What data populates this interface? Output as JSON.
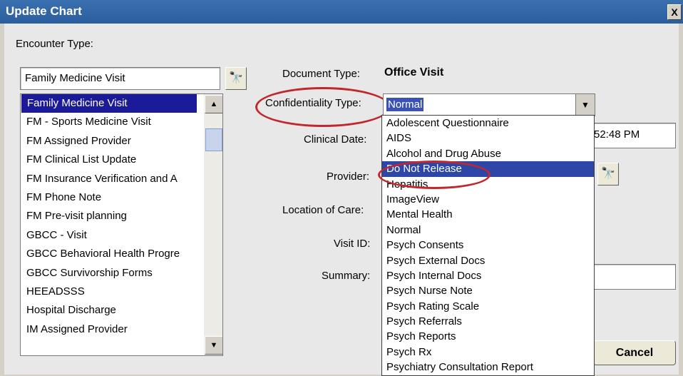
{
  "window": {
    "title": "Update Chart",
    "close_glyph": "X"
  },
  "encounter": {
    "label": "Encounter Type:",
    "value": "Family Medicine Visit",
    "items": [
      {
        "label": "Family Medicine Visit",
        "selected": true
      },
      {
        "label": "FM - Sports Medicine Visit"
      },
      {
        "label": "FM Assigned Provider"
      },
      {
        "label": "FM Clinical List Update"
      },
      {
        "label": "FM Insurance Verification and A"
      },
      {
        "label": "FM Phone Note"
      },
      {
        "label": "FM Pre-visit planning"
      },
      {
        "label": "GBCC - Visit"
      },
      {
        "label": "GBCC Behavioral Health Progre"
      },
      {
        "label": "GBCC Survivorship Forms"
      },
      {
        "label": "HEEADSSS"
      },
      {
        "label": "Hospital Discharge"
      },
      {
        "label": "IM Assigned Provider"
      }
    ]
  },
  "document": {
    "label": "Document Type:",
    "value": "Office Visit"
  },
  "confidentiality": {
    "label": "Confidentiality Type:",
    "value": "Normal",
    "options": [
      {
        "label": "Adolescent Questionnaire"
      },
      {
        "label": "AIDS"
      },
      {
        "label": "Alcohol and Drug Abuse"
      },
      {
        "label": "Do Not Release",
        "highlighted": true
      },
      {
        "label": "Hepatitis"
      },
      {
        "label": "ImageView"
      },
      {
        "label": "Mental Health"
      },
      {
        "label": "Normal"
      },
      {
        "label": "Psych Consents"
      },
      {
        "label": "Psych External Docs"
      },
      {
        "label": "Psych Internal Docs"
      },
      {
        "label": "Psych Nurse Note"
      },
      {
        "label": "Psych Rating Scale"
      },
      {
        "label": "Psych Referrals"
      },
      {
        "label": "Psych Reports"
      },
      {
        "label": "Psych Rx"
      },
      {
        "label": "Psychiatry Consultation Report"
      }
    ]
  },
  "clinical_date": {
    "label": "Clinical Date:",
    "value_visible": "52:48 PM"
  },
  "provider": {
    "label": "Provider:"
  },
  "location": {
    "label": "Location of Care:"
  },
  "visit": {
    "label": "Visit ID:"
  },
  "summary": {
    "label": "Summary:"
  },
  "buttons": {
    "cancel": "Cancel",
    "lookup_glyph": "🔭"
  },
  "colors": {
    "titlebar": "#2b5e9e",
    "selection": "#1b1b9a",
    "highlight": "#2d47a9",
    "annotation": "#c0282e"
  }
}
